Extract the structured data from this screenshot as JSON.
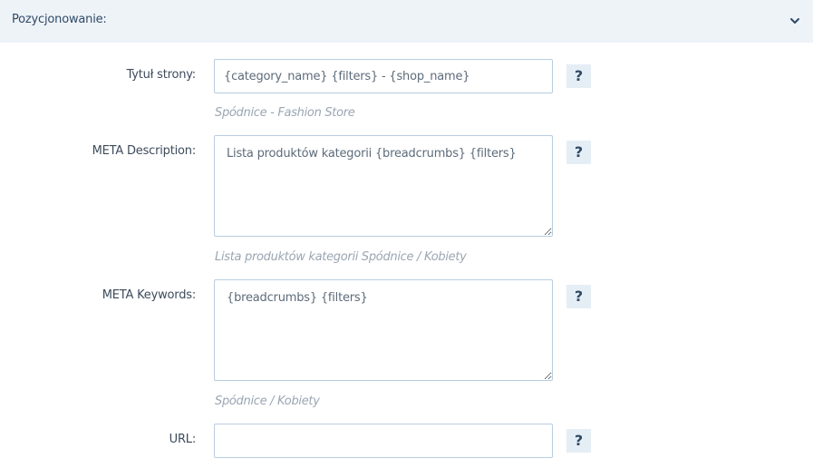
{
  "section": {
    "title": "Pozycjonowanie:",
    "toggle_icon": "chevron-down-icon"
  },
  "fields": {
    "page_title": {
      "label": "Tytuł strony:",
      "value": "{category_name} {filters} - {shop_name}",
      "hint": "Spódnice - Fashion Store",
      "help": "?"
    },
    "meta_description": {
      "label": "META Description:",
      "value": "Lista produktów kategorii {breadcrumbs} {filters}",
      "hint": "Lista produktów kategorii Spódnice / Kobiety",
      "help": "?"
    },
    "meta_keywords": {
      "label": "META Keywords:",
      "value": "{breadcrumbs} {filters}",
      "hint": "Spódnice / Kobiety",
      "help": "?"
    },
    "url": {
      "label": "URL:",
      "value": "",
      "help": "?"
    }
  },
  "colors": {
    "header_bg": "#eef3f8",
    "accent": "#2f4a66",
    "field_border": "#b8cde0",
    "hint": "#9aa6b2"
  }
}
